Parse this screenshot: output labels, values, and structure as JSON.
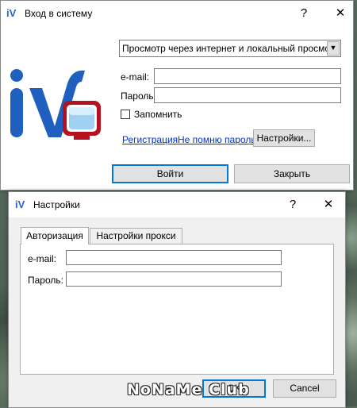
{
  "login_window": {
    "icon_text": "iV",
    "title": "Вход в систему",
    "help_glyph": "?",
    "close_glyph": "✕",
    "mode_select": {
      "value": "Просмотр через интернет и локальный просмотр"
    },
    "email_label": "e-mail:",
    "email_value": "",
    "password_label": "Пароль:",
    "password_value": "",
    "remember_label": "Запомнить",
    "register_link": "Регистрация",
    "forgot_link": "Не помню пароль",
    "settings_button": "Настройки...",
    "login_button": "Войти",
    "close_button": "Закрыть",
    "logo_text": "iV"
  },
  "settings_window": {
    "icon_text": "iV",
    "title": "Настройки",
    "help_glyph": "?",
    "close_glyph": "✕",
    "tabs": [
      {
        "label": "Авторизация",
        "active": true
      },
      {
        "label": "Настройки прокси",
        "active": false
      }
    ],
    "email_label": "e-mail:",
    "email_value": "",
    "password_label": "Пароль:",
    "password_value": "",
    "ok_button": "OK",
    "cancel_button": "Cancel"
  },
  "watermark": "NoNaMe Club",
  "colors": {
    "accent": "#0078d7",
    "logo_blue": "#1f5fbf",
    "logo_red": "#b3121e",
    "link": "#0033cc"
  }
}
